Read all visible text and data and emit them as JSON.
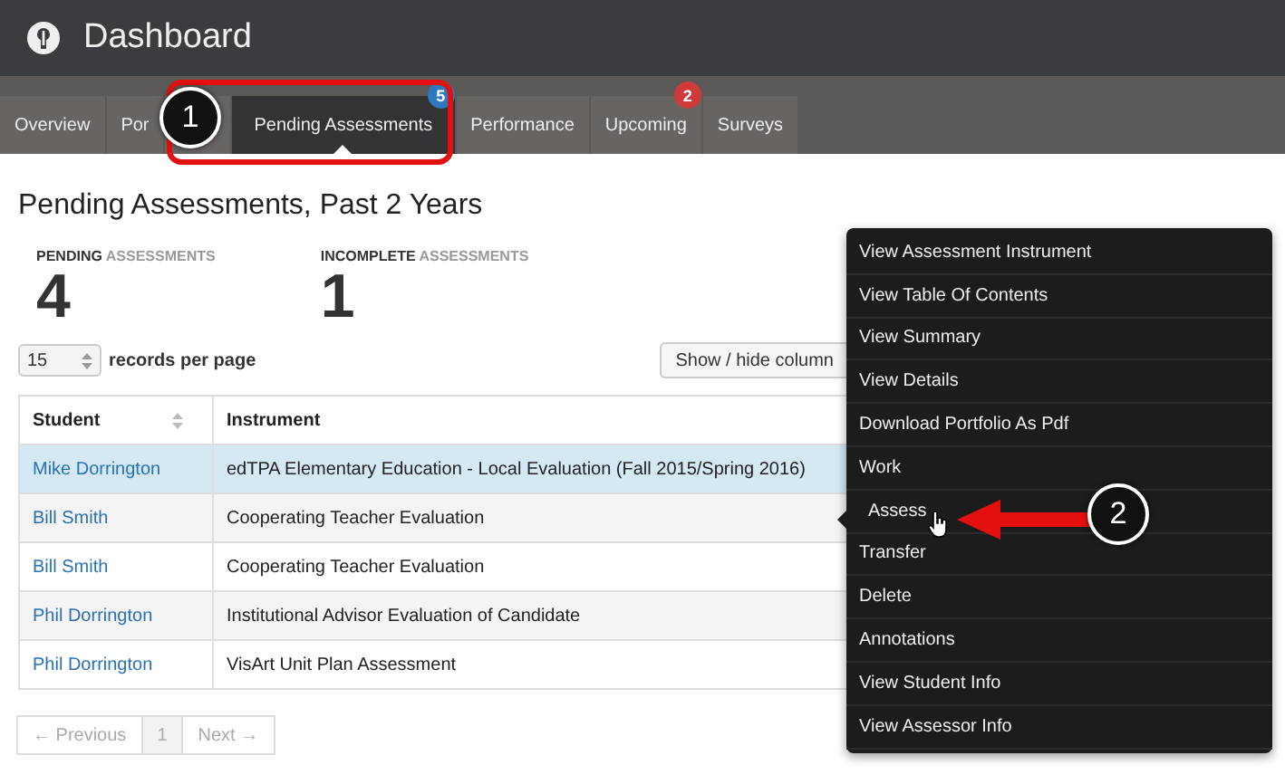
{
  "header": {
    "title": "Dashboard"
  },
  "tabs": [
    {
      "label": "Overview",
      "selected": false
    },
    {
      "label": "Por",
      "selected": false
    },
    {
      "label": "Pending Assessments",
      "selected": true,
      "badge": {
        "text": "5",
        "color": "#2e78bd"
      }
    },
    {
      "label": "Performance",
      "selected": false
    },
    {
      "label": "Upcoming",
      "selected": false,
      "badge": {
        "text": "2",
        "color": "#d03a3a"
      }
    },
    {
      "label": "Surveys",
      "selected": false
    }
  ],
  "page_title": "Pending Assessments, Past 2 Years",
  "stats": [
    {
      "label": "**PENDING** ASSESSMENTS",
      "value": "4"
    },
    {
      "label": "**INCOMPLETE** ASSESSMENTS",
      "value": "1"
    }
  ],
  "records": {
    "value": "15",
    "label": "records per page"
  },
  "toolbar": {
    "show_hide": "Show / hide column"
  },
  "table": {
    "columns": [
      {
        "label": "Student",
        "sortable": true
      },
      {
        "label": "Instrument",
        "sortable": false
      }
    ],
    "rows": [
      {
        "student": "Mike Dorrington",
        "instrument": "edTPA Elementary Education - Local Evaluation (Fall 2015/Spring 2016)",
        "selected": true
      },
      {
        "student": "Bill Smith",
        "instrument": "Cooperating Teacher Evaluation",
        "selected": false
      },
      {
        "student": "Bill Smith",
        "instrument": "Cooperating Teacher Evaluation",
        "selected": false
      },
      {
        "student": "Phil Dorrington",
        "instrument": "Institutional Advisor Evaluation of Candidate",
        "selected": false
      },
      {
        "student": "Phil Dorrington",
        "instrument": "VisArt Unit Plan Assessment",
        "selected": false
      }
    ]
  },
  "pagination": [
    {
      "label": "← Previous",
      "selected": false
    },
    {
      "label": "1",
      "selected": true
    },
    {
      "label": "Next →",
      "selected": false
    }
  ],
  "context_menu": [
    {
      "label": "View Assessment Instrument",
      "selected": false
    },
    {
      "label": "View Table Of Contents",
      "selected": false
    },
    {
      "label": "View Summary",
      "selected": false
    },
    {
      "label": "View Details",
      "selected": false
    },
    {
      "label": "Download Portfolio As Pdf",
      "selected": false
    },
    {
      "label": "Work",
      "selected": false
    },
    {
      "label": "Assess",
      "selected": true
    },
    {
      "label": "Transfer",
      "selected": false
    },
    {
      "label": "Delete",
      "selected": false
    },
    {
      "label": "Annotations",
      "selected": false
    },
    {
      "label": "View Student Info",
      "selected": false
    },
    {
      "label": "View Assessor Info",
      "selected": false
    }
  ],
  "callouts": [
    {
      "number": "1"
    },
    {
      "number": "2"
    }
  ]
}
